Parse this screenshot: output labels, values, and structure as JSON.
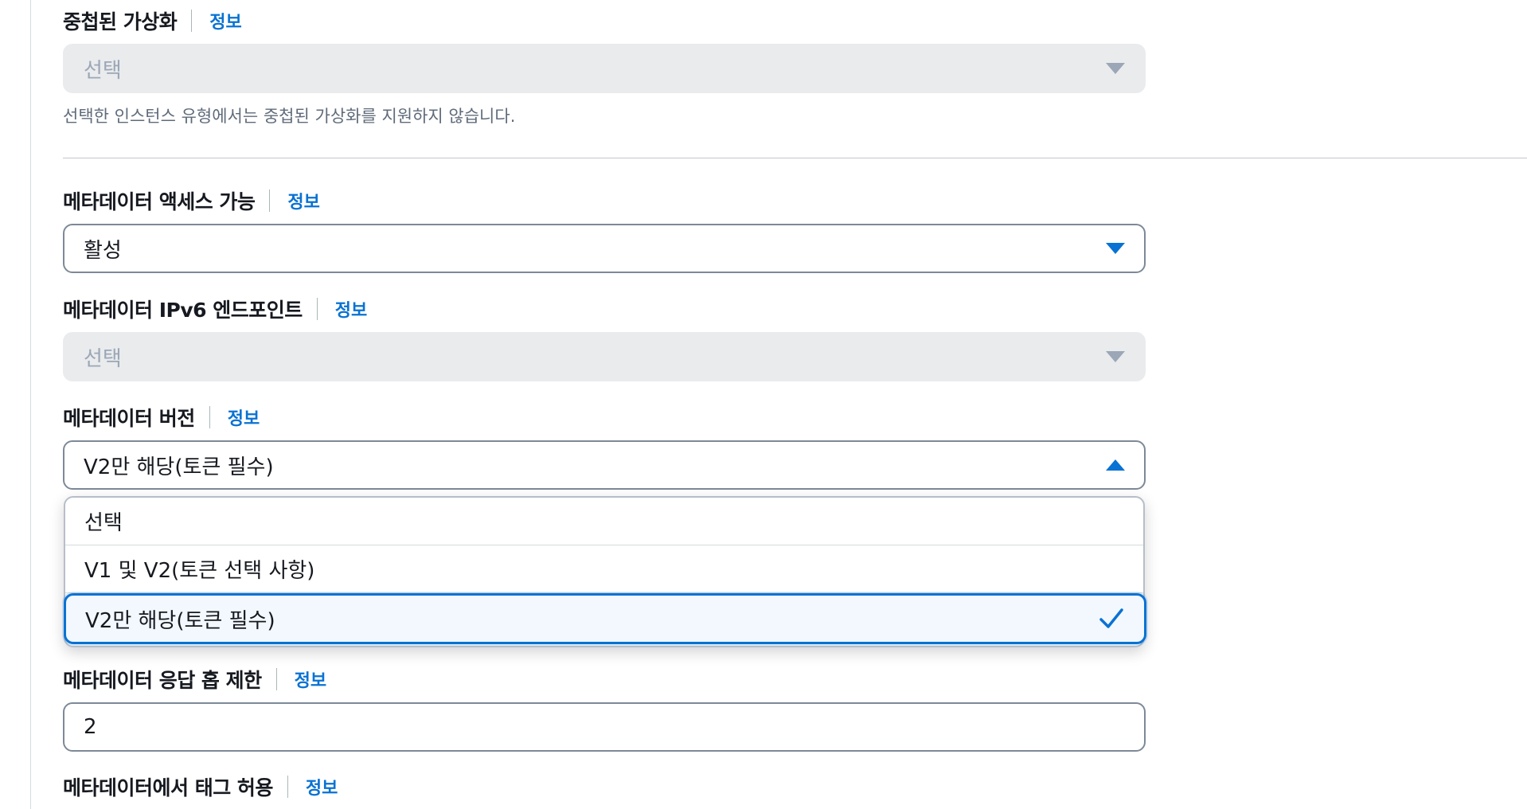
{
  "nested_virtualization": {
    "label": "중첩된 가상화",
    "info": "정보",
    "select_value": "선택",
    "hint": "선택한 인스턴스 유형에서는 중첩된 가상화를 지원하지 않습니다."
  },
  "metadata_access": {
    "label": "메타데이터 액세스 가능",
    "info": "정보",
    "select_value": "활성"
  },
  "metadata_ipv6": {
    "label": "메타데이터 IPv6 엔드포인트",
    "info": "정보",
    "select_value": "선택"
  },
  "metadata_version": {
    "label": "메타데이터 버전",
    "info": "정보",
    "select_value": "V2만 해당(토큰 필수)",
    "options": [
      "선택",
      "V1 및 V2(토큰 선택 사항)",
      "V2만 해당(토큰 필수)"
    ],
    "selected_index": 2
  },
  "hop_limit": {
    "label": "메타데이터 응답 홉 제한",
    "info": "정보",
    "value": "2"
  },
  "tags_in_metadata": {
    "label": "메타데이터에서 태그 허용",
    "info": "정보"
  },
  "colors": {
    "link": "#0972d3",
    "selected_bg": "#f2f8fd",
    "disabled_bg": "#e9ebed"
  }
}
